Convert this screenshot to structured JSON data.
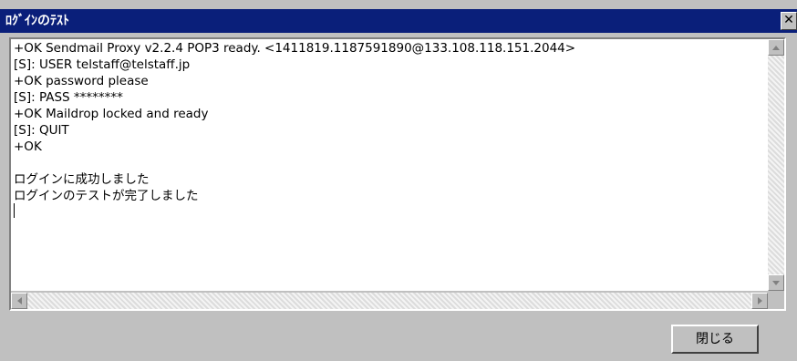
{
  "window": {
    "title": "ﾛｸﾞｲﾝのﾃｽﾄ",
    "close_glyph": "✕"
  },
  "log": {
    "lines": [
      "+OK Sendmail Proxy v2.2.4 POP3 ready. <1411819.1187591890@133.108.118.151.2044>",
      "[S]: USER telstaff@telstaff.jp",
      "+OK password please",
      "[S]: PASS ********",
      "+OK Maildrop locked and ready",
      "[S]: QUIT",
      "+OK",
      "",
      "ログインに成功しました",
      "ログインのテストが完了しました"
    ]
  },
  "footer": {
    "close_label": "閉じる"
  },
  "icons": {
    "scroll_up": "arrow-up-icon",
    "scroll_down": "arrow-down-icon",
    "scroll_left": "arrow-left-icon",
    "scroll_right": "arrow-right-icon"
  },
  "colors": {
    "titlebar": "#0a1f7a",
    "face": "#c0c0c0"
  }
}
